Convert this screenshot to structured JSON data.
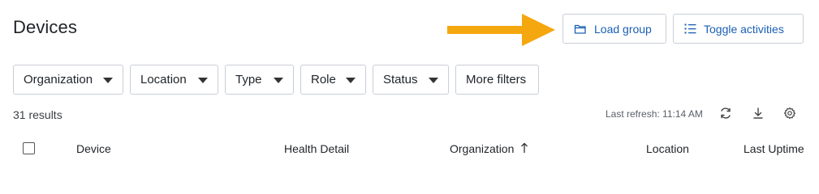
{
  "page": {
    "title": "Devices"
  },
  "toolbar": {
    "load_group_label": "Load group",
    "load_group_icon": "folder-icon",
    "toggle_activities_label": "Toggle activities",
    "toggle_activities_icon": "list-icon"
  },
  "annotation": {
    "arrow_color": "#f5a70f"
  },
  "filters": [
    {
      "label": "Organization"
    },
    {
      "label": "Location"
    },
    {
      "label": "Type"
    },
    {
      "label": "Role"
    },
    {
      "label": "Status"
    }
  ],
  "more_filters_label": "More filters",
  "results": {
    "count_text": "31 results",
    "last_refresh": "Last refresh: 11:14 AM"
  },
  "table": {
    "columns": [
      {
        "label": "Device"
      },
      {
        "label": "Health Detail"
      },
      {
        "label": "Organization",
        "sort": "ascending"
      },
      {
        "label": "Location"
      },
      {
        "label": "Last Uptime"
      }
    ]
  },
  "colors": {
    "accent": "#1a5fb4",
    "border": "#c9ced6"
  }
}
